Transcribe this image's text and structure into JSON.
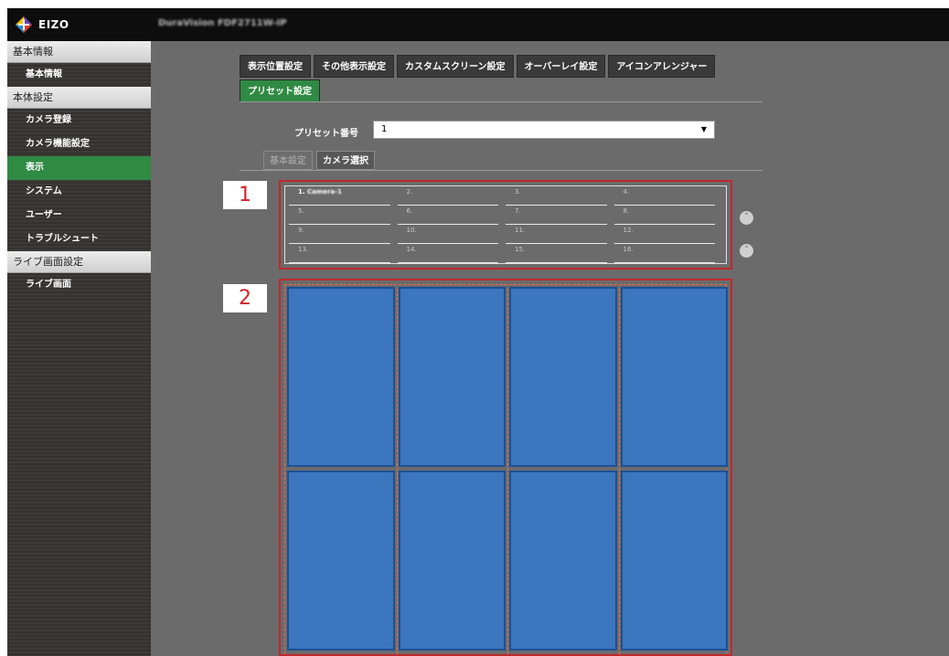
{
  "header": {
    "logo_text": "EIZO",
    "device_name": "DuraVision FDF2711W-IP"
  },
  "sidebar": {
    "sections": [
      {
        "label": "基本情報",
        "items": [
          {
            "label": "基本情報",
            "active": false
          }
        ]
      },
      {
        "label": "本体設定",
        "items": [
          {
            "label": "カメラ登録",
            "active": false
          },
          {
            "label": "カメラ機能設定",
            "active": false
          },
          {
            "label": "表示",
            "active": true
          },
          {
            "label": "システム",
            "active": false
          },
          {
            "label": "ユーザー",
            "active": false
          },
          {
            "label": "トラブルシュート",
            "active": false
          }
        ]
      },
      {
        "label": "ライブ画面設定",
        "items": [
          {
            "label": "ライブ画面",
            "active": false
          }
        ]
      }
    ]
  },
  "tabs": {
    "row1": [
      "表示位置設定",
      "その他表示設定",
      "カスタムスクリーン設定",
      "オーバーレイ設定",
      "アイコンアレンジャー"
    ],
    "row2": [
      "プリセット設定"
    ],
    "active": "プリセット設定"
  },
  "preset": {
    "label": "プリセット番号",
    "value": "1"
  },
  "subtabs": {
    "items": [
      "基本設定",
      "カメラ選択"
    ],
    "active": "カメラ選択"
  },
  "callouts": [
    "1",
    "2"
  ],
  "camera_list": {
    "cells": [
      {
        "num": "1.",
        "name": "Camera-1",
        "selected": true
      },
      {
        "num": "2.",
        "name": "",
        "selected": false
      },
      {
        "num": "3.",
        "name": "",
        "selected": false
      },
      {
        "num": "4.",
        "name": "",
        "selected": false
      },
      {
        "num": "5.",
        "name": "",
        "selected": false
      },
      {
        "num": "6.",
        "name": "",
        "selected": false
      },
      {
        "num": "7.",
        "name": "",
        "selected": false
      },
      {
        "num": "8.",
        "name": "",
        "selected": false
      },
      {
        "num": "9.",
        "name": "",
        "selected": false
      },
      {
        "num": "10.",
        "name": "",
        "selected": false
      },
      {
        "num": "11.",
        "name": "",
        "selected": false
      },
      {
        "num": "12.",
        "name": "",
        "selected": false
      },
      {
        "num": "13.",
        "name": "",
        "selected": false
      },
      {
        "num": "14.",
        "name": "",
        "selected": false
      },
      {
        "num": "15.",
        "name": "",
        "selected": false
      },
      {
        "num": "16.",
        "name": "",
        "selected": false
      }
    ]
  },
  "layout_preview": {
    "columns": 4,
    "rows": 2,
    "pane_color": "#3b76bf"
  },
  "colors": {
    "accent_green": "#2f8a43",
    "highlight_red": "#c0282d",
    "background": "#6b6b6b"
  },
  "icons": {
    "scroll_up": "chevron-up-icon",
    "scroll_down": "chevron-down-icon"
  }
}
